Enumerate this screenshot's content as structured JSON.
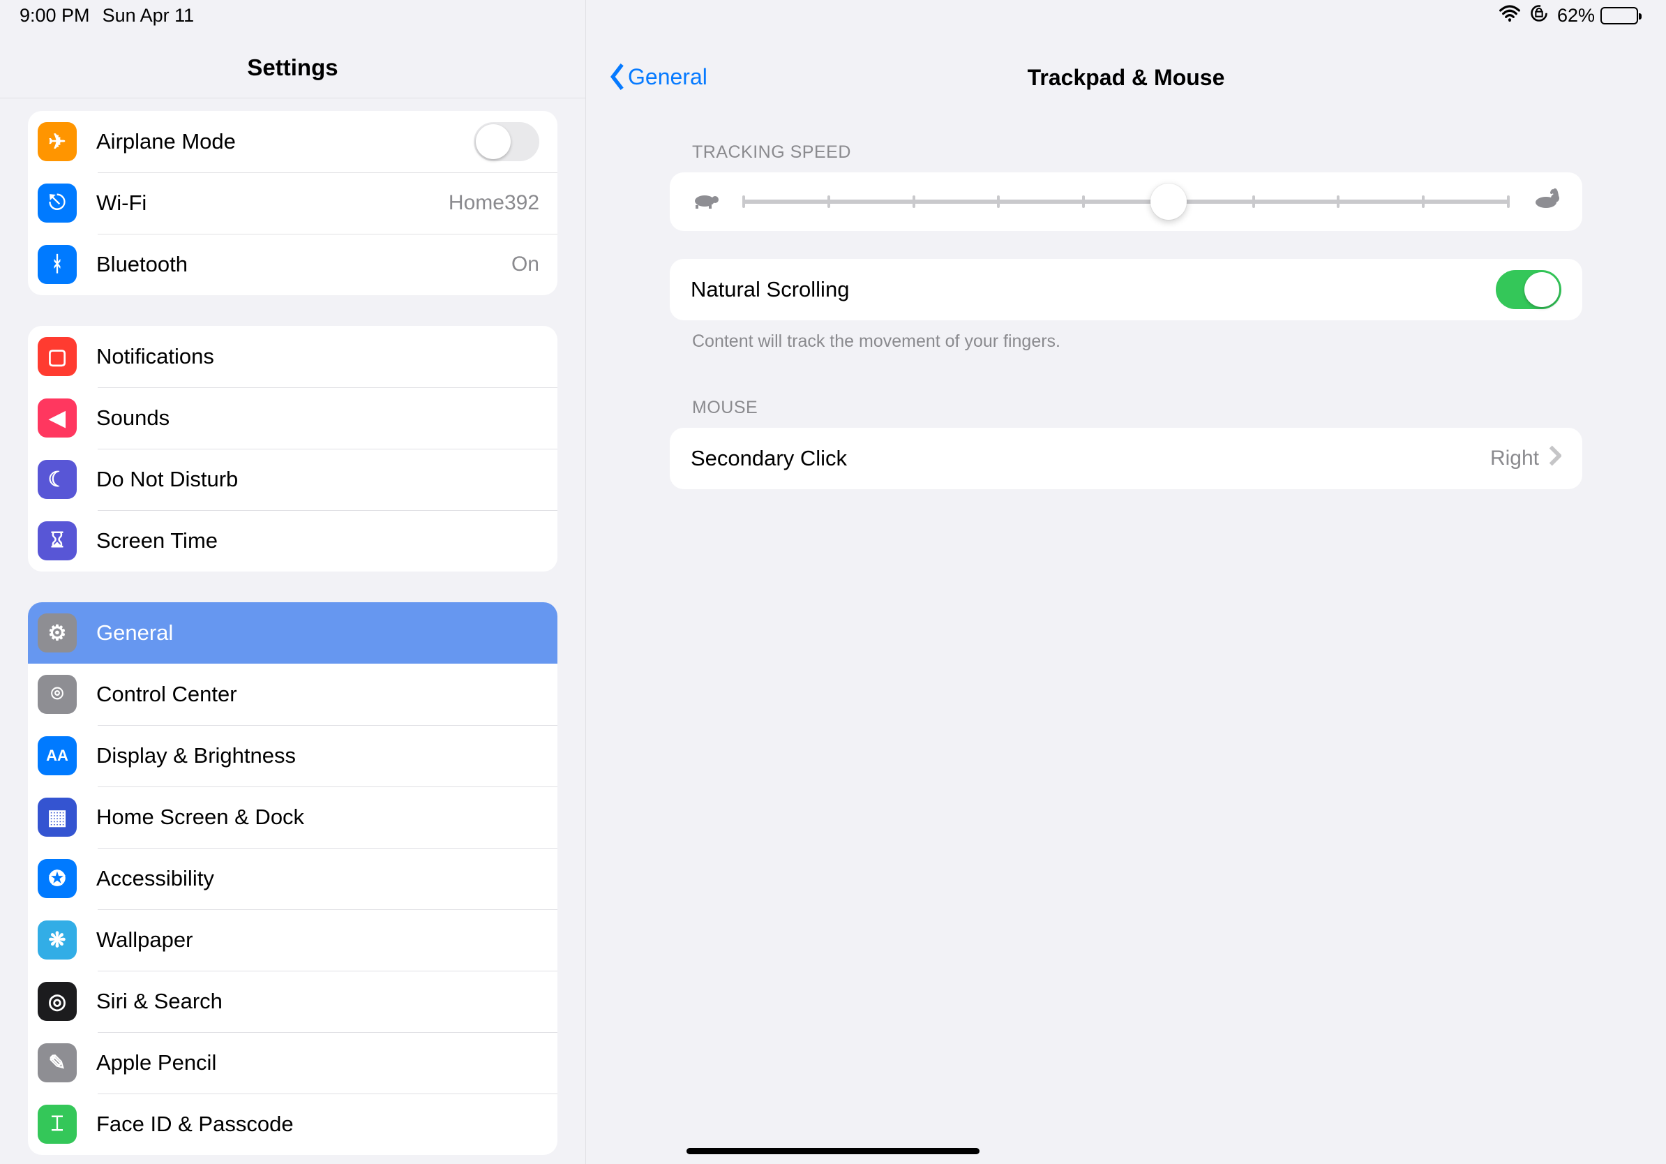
{
  "statusbar": {
    "time": "9:00 PM",
    "date": "Sun Apr 11",
    "battery_pct": "62%",
    "battery_fill": 62
  },
  "sidebar": {
    "title": "Settings",
    "groups": [
      [
        {
          "icon": "ic-airplane",
          "glyph": "✈",
          "label": "Airplane Mode",
          "toggle": false
        },
        {
          "icon": "ic-wifi",
          "glyph": "⎋",
          "label": "Wi-Fi",
          "value": "Home392"
        },
        {
          "icon": "ic-bt",
          "glyph": "ᚼ",
          "label": "Bluetooth",
          "value": "On"
        }
      ],
      [
        {
          "icon": "ic-notif",
          "glyph": "▢",
          "label": "Notifications"
        },
        {
          "icon": "ic-sounds",
          "glyph": "◀︎",
          "label": "Sounds"
        },
        {
          "icon": "ic-dnd",
          "glyph": "☾",
          "label": "Do Not Disturb"
        },
        {
          "icon": "ic-screen",
          "glyph": "⌛︎",
          "label": "Screen Time"
        }
      ],
      [
        {
          "icon": "ic-general",
          "glyph": "⚙",
          "label": "General",
          "selected": true
        },
        {
          "icon": "ic-control",
          "glyph": "⌾",
          "label": "Control Center"
        },
        {
          "icon": "ic-display",
          "glyph": "AA",
          "label": "Display & Brightness",
          "small": true
        },
        {
          "icon": "ic-home",
          "glyph": "▦",
          "label": "Home Screen & Dock"
        },
        {
          "icon": "ic-access",
          "glyph": "✪",
          "label": "Accessibility"
        },
        {
          "icon": "ic-wall",
          "glyph": "❋",
          "label": "Wallpaper"
        },
        {
          "icon": "ic-siri",
          "glyph": "◎",
          "label": "Siri & Search"
        },
        {
          "icon": "ic-pencil",
          "glyph": "✎",
          "label": "Apple Pencil"
        },
        {
          "icon": "ic-face",
          "glyph": "⌶",
          "label": "Face ID & Passcode"
        }
      ]
    ]
  },
  "detail": {
    "back_label": "General",
    "title": "Trackpad & Mouse",
    "tracking_header": "TRACKING SPEED",
    "tracking_value_index": 5,
    "tracking_steps": 10,
    "natural_label": "Natural Scrolling",
    "natural_on": true,
    "natural_footer": "Content will track the movement of your fingers.",
    "mouse_header": "MOUSE",
    "secondary_label": "Secondary Click",
    "secondary_value": "Right"
  }
}
